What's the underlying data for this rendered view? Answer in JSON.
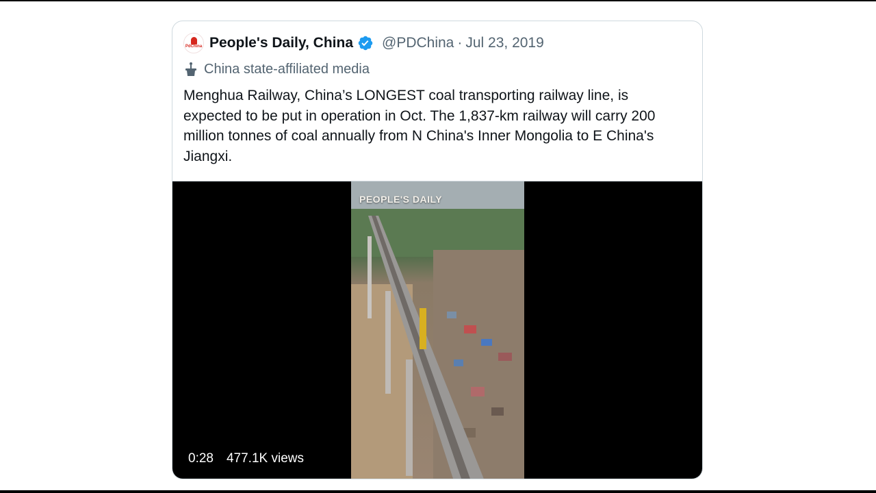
{
  "tweet": {
    "display_name": "People's Daily, China",
    "handle": "@PDChina",
    "separator": "·",
    "date": "Jul 23, 2019",
    "label": "China state-affiliated media",
    "text": "Menghua Railway, China’s LONGEST coal transporting railway line, is expected to be put in operation in Oct. The 1,837-km railway will carry 200 million tonnes of coal annually from N China's Inner Mongolia to E China's Jiangxi.",
    "avatar_text": "PdChina"
  },
  "media": {
    "overlay_text": "PEOPLE'S DAILY",
    "duration": "0:28",
    "views": "477.1K views"
  },
  "colors": {
    "verified": "#1d9bf0",
    "secondary_text": "#536471",
    "border": "#cfd9de",
    "avatar_brand": "#d6281f"
  },
  "icons": {
    "verified": "verified-badge-icon",
    "label": "podium-icon"
  }
}
